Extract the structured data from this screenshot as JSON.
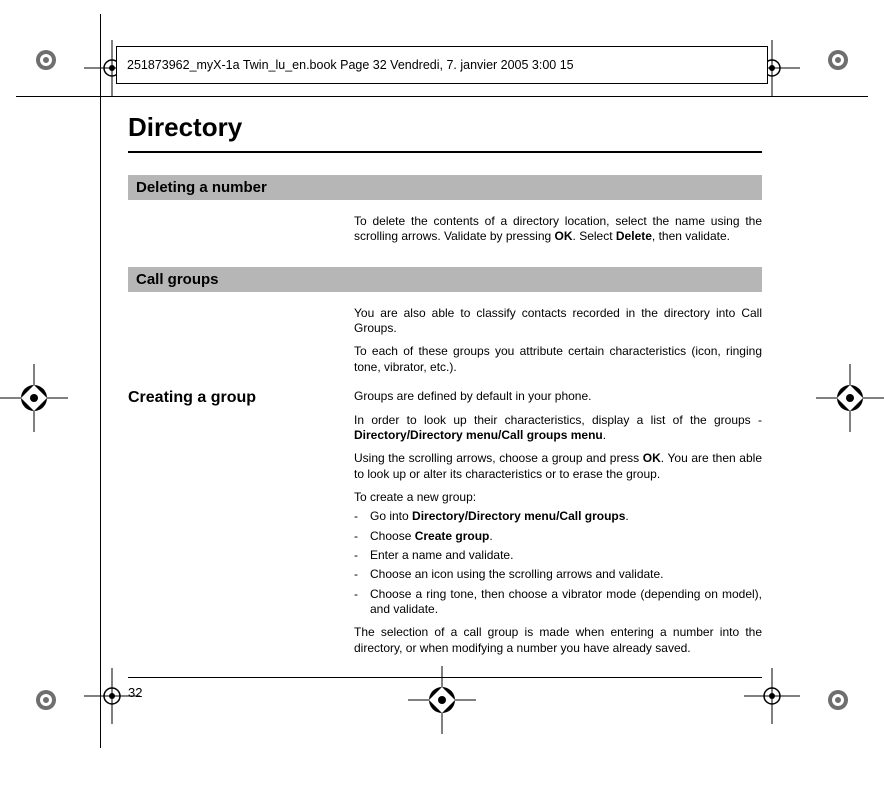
{
  "header_text": "251873962_myX-1a Twin_lu_en.book  Page 32  Vendredi, 7. janvier 2005  3:00 15",
  "page_title": "Directory",
  "page_number": "32",
  "sections": {
    "s1": {
      "heading": "Deleting a number",
      "body_html": "To delete the contents of a directory location, select the name using the scrolling arrows. Validate by pressing <b>OK</b>. Select <b>Delete</b>, then validate."
    },
    "s2": {
      "heading": "Call groups",
      "intro_p1": "You are also able to classify contacts recorded in the directory into Call Groups.",
      "intro_p2": "To each of these groups you attribute certain characteristics (icon, ringing tone, vibrator, etc.).",
      "subheading": "Creating a group",
      "p1": "Groups are defined by default in your phone.",
      "p2_html": "In order to look up their characteristics, display a list of the groups - <b>Directory/Directory menu/Call groups menu</b>.",
      "p3_html": "Using the scrolling arrows, choose a group and press <b>OK</b>. You are then able to look up or alter its characteristics or to erase the group.",
      "p4": "To create a new group:",
      "list": [
        "Go into <b>Directory/Directory menu/Call groups</b>.",
        "Choose <b>Create group</b>.",
        "Enter a name and validate.",
        "Choose an icon using the scrolling arrows and validate.",
        "Choose a ring tone, then choose a vibrator mode (depending on model), and validate."
      ],
      "p5": "The selection of a call group is made when entering a number into the directory, or when modifying a number you have already saved."
    }
  }
}
